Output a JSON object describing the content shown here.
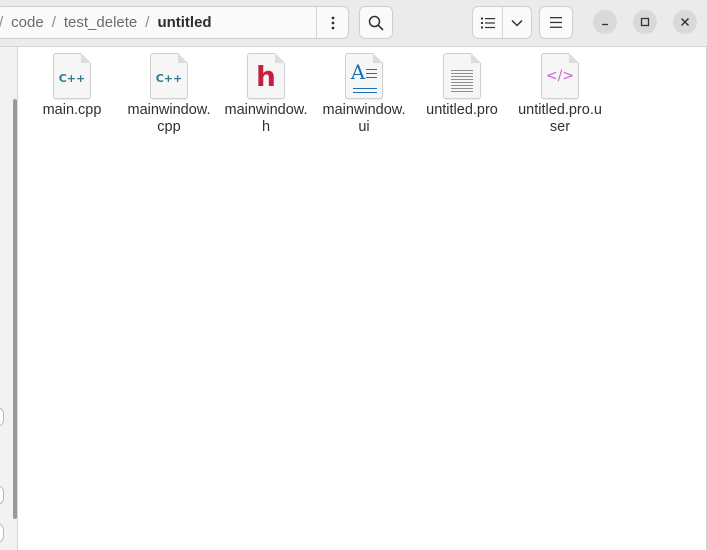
{
  "header": {
    "breadcrumbs": [
      "code",
      "test_delete",
      "untitled"
    ],
    "separator": "/",
    "leading_separator": "/",
    "path_menu_icon": "vertical-dots-icon",
    "search_icon": "search-icon",
    "view_list_icon": "list-view-icon",
    "view_dropdown_icon": "chevron-down-icon",
    "menu_icon": "hamburger-menu-icon",
    "window_controls": [
      "minimize-icon",
      "maximize-icon",
      "close-icon"
    ]
  },
  "files": [
    {
      "name": "main.cpp",
      "icon": "cpp-file-icon",
      "glyph": "C++",
      "glyph_color": "#2a7d8c"
    },
    {
      "name": "mainwindow.cpp",
      "icon": "cpp-file-icon",
      "glyph": "C++",
      "glyph_color": "#2a7d8c"
    },
    {
      "name": "mainwindow.h",
      "icon": "header-file-icon",
      "glyph": "h",
      "glyph_color": "#c8203a"
    },
    {
      "name": "mainwindow.ui",
      "icon": "ui-file-icon",
      "glyph": "A",
      "glyph_color": "#1f6fb5"
    },
    {
      "name": "untitled.pro",
      "icon": "text-file-icon",
      "glyph": "",
      "glyph_color": "#8f8f8f"
    },
    {
      "name": "untitled.pro.user",
      "icon": "xml-file-icon",
      "glyph": "</>",
      "glyph_color": "#d45fd0"
    }
  ],
  "colors": {
    "header_bg": "#ebebeb",
    "content_bg": "#ffffff"
  }
}
